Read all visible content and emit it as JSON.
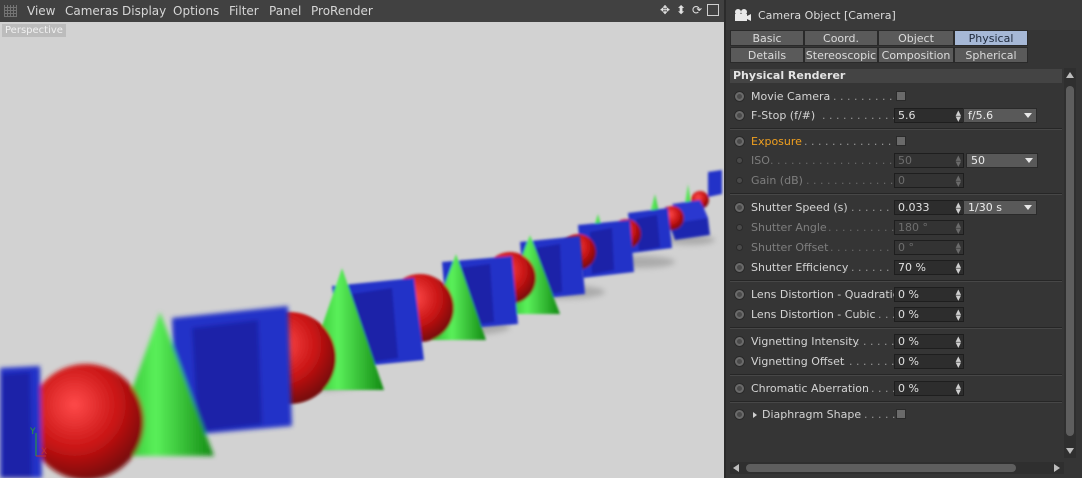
{
  "viewport": {
    "menu": [
      "View",
      "Cameras",
      "Display",
      "Options",
      "Filter",
      "Panel",
      "ProRender"
    ],
    "label": "Perspective",
    "axis": {
      "y": "Y",
      "x": "X"
    },
    "nav_icons": [
      "move-icon",
      "zoom-icon",
      "rotate-icon",
      "maximize-icon"
    ]
  },
  "panel": {
    "title": "Camera Object [Camera]",
    "tabs_row1": [
      {
        "label": "Basic",
        "active": false
      },
      {
        "label": "Coord.",
        "active": false
      },
      {
        "label": "Object",
        "active": false
      },
      {
        "label": "Physical",
        "active": true
      }
    ],
    "tabs_row2": [
      {
        "label": "Details",
        "active": false
      },
      {
        "label": "Stereoscopic",
        "active": false
      },
      {
        "label": "Composition",
        "active": false
      },
      {
        "label": "Spherical",
        "active": false
      }
    ],
    "section": "Physical Renderer",
    "params": {
      "movie_camera": {
        "label": "Movie Camera"
      },
      "fstop": {
        "label": "F-Stop (f/#)",
        "value": "5.6",
        "preset": "f/5.6"
      },
      "exposure": {
        "label": "Exposure"
      },
      "iso": {
        "label": "ISO",
        "value": "50",
        "preset": "50"
      },
      "gain": {
        "label": "Gain (dB)",
        "value": "0"
      },
      "shutter_speed": {
        "label": "Shutter Speed (s)",
        "value": "0.033",
        "preset": "1/30 s"
      },
      "shutter_angle": {
        "label": "Shutter Angle",
        "value": "180 °"
      },
      "shutter_offset": {
        "label": "Shutter Offset",
        "value": "0 °"
      },
      "shutter_efficiency": {
        "label": "Shutter Efficiency",
        "value": "70 %"
      },
      "lens_quadratic": {
        "label": "Lens Distortion - Quadratic",
        "value": "0 %"
      },
      "lens_cubic": {
        "label": "Lens Distortion - Cubic",
        "value": "0 %"
      },
      "vignetting_intensity": {
        "label": "Vignetting Intensity",
        "value": "0 %"
      },
      "vignetting_offset": {
        "label": "Vignetting Offset",
        "value": "0 %"
      },
      "chromatic_aberration": {
        "label": "Chromatic Aberration",
        "value": "0 %"
      },
      "diaphragm_shape": {
        "label": "Diaphragm Shape"
      }
    }
  },
  "colors": {
    "accent": "#a6b8d6",
    "exposure_label": "#f0a020",
    "sphere": "#c41818",
    "cone": "#22c422",
    "cube": "#2430c8"
  }
}
